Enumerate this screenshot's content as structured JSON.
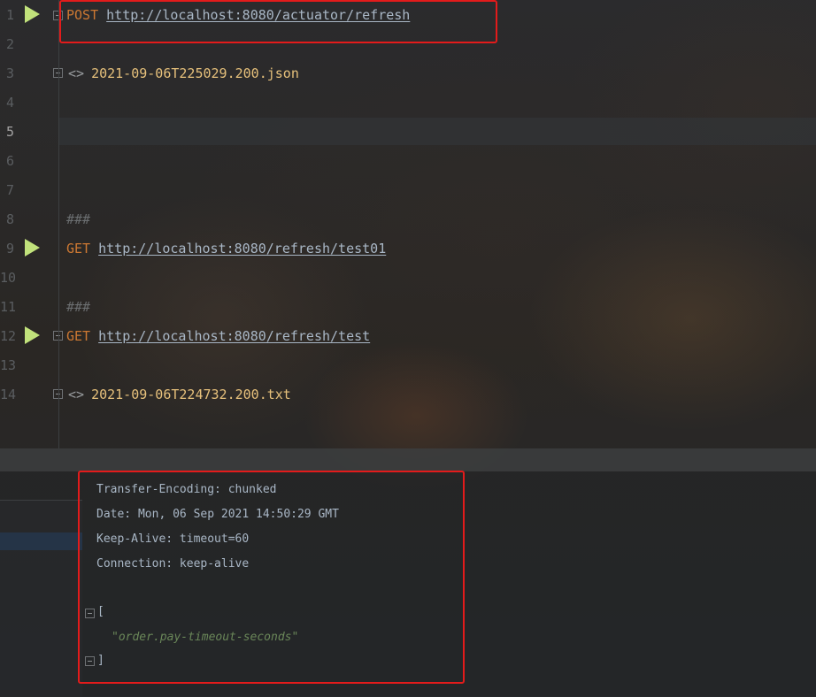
{
  "editor": {
    "line_numbers": [
      "1",
      "2",
      "3",
      "4",
      "5",
      "6",
      "7",
      "8",
      "9",
      "10",
      "11",
      "12",
      "13",
      "14"
    ],
    "current_line": "5",
    "lines": {
      "l1": {
        "method": "POST",
        "url": "http://localhost:8080/actuator/refresh"
      },
      "l3": {
        "file": "2021-09-06T225029.200.json"
      },
      "l8": {
        "separator": "###"
      },
      "l9": {
        "method": "GET",
        "url": "http://localhost:8080/refresh/test01"
      },
      "l11": {
        "separator": "###"
      },
      "l12": {
        "method": "GET",
        "url": "http://localhost:8080/refresh/test"
      },
      "l14": {
        "file": "2021-09-06T224732.200.txt"
      }
    },
    "diamond_glyph": "<>"
  },
  "response": {
    "headers": [
      "Transfer-Encoding: chunked",
      "Date: Mon, 06 Sep 2021 14:50:29 GMT",
      "Keep-Alive: timeout=60",
      "Connection: keep-alive"
    ],
    "body_open": "[",
    "body_item": "\"order.pay-timeout-seconds\"",
    "body_close": "]"
  },
  "colors": {
    "method": "#cc7832",
    "url": "#a9b7c6",
    "run_icon": "#c1e27b",
    "file_ref": "#e6c07b",
    "highlight": "#e31b1b",
    "json_string": "#6a8759"
  }
}
